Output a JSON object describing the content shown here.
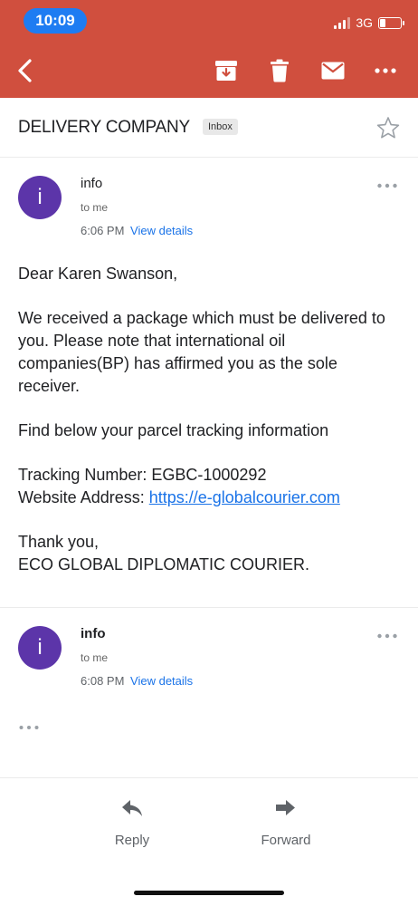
{
  "status_bar": {
    "time": "10:09",
    "network": "3G",
    "signal_bars_filled": 3,
    "signal_bars_total": 4,
    "battery_level": 0.25
  },
  "toolbar": {
    "back_icon": "chevron-left-icon",
    "archive_icon": "archive-icon",
    "delete_icon": "trash-icon",
    "mail_icon": "envelope-icon",
    "more_icon": "more-horizontal-icon"
  },
  "subject": {
    "title": "DELIVERY COMPANY",
    "label": "Inbox",
    "star_icon": "star-outline-icon"
  },
  "messages": [
    {
      "avatar_letter": "i",
      "sender": "info",
      "recipient": "to me",
      "time": "6:06 PM",
      "view_details": "View details",
      "body": {
        "greeting": "Dear Karen Swanson,",
        "paragraph1": "We received a package which must be delivered to you. Please note that international oil companies(BP) has affirmed you as the sole receiver.",
        "paragraph2": "Find below your parcel tracking information",
        "tracking_line": "Tracking Number: EGBC-1000292",
        "website_label": "Website Address: ",
        "website_link": "https://e-globalcourier.com",
        "signoff": "Thank you,",
        "signature": "ECO GLOBAL DIPLOMATIC COURIER."
      }
    },
    {
      "avatar_letter": "i",
      "sender": "info",
      "recipient": "to me",
      "time": "6:08 PM",
      "view_details": "View details"
    }
  ],
  "actions": {
    "reply_label": "Reply",
    "forward_label": "Forward"
  },
  "colors": {
    "header_red": "#d04f3e",
    "avatar_purple": "#5c35a9",
    "link_blue": "#1a73e8"
  }
}
